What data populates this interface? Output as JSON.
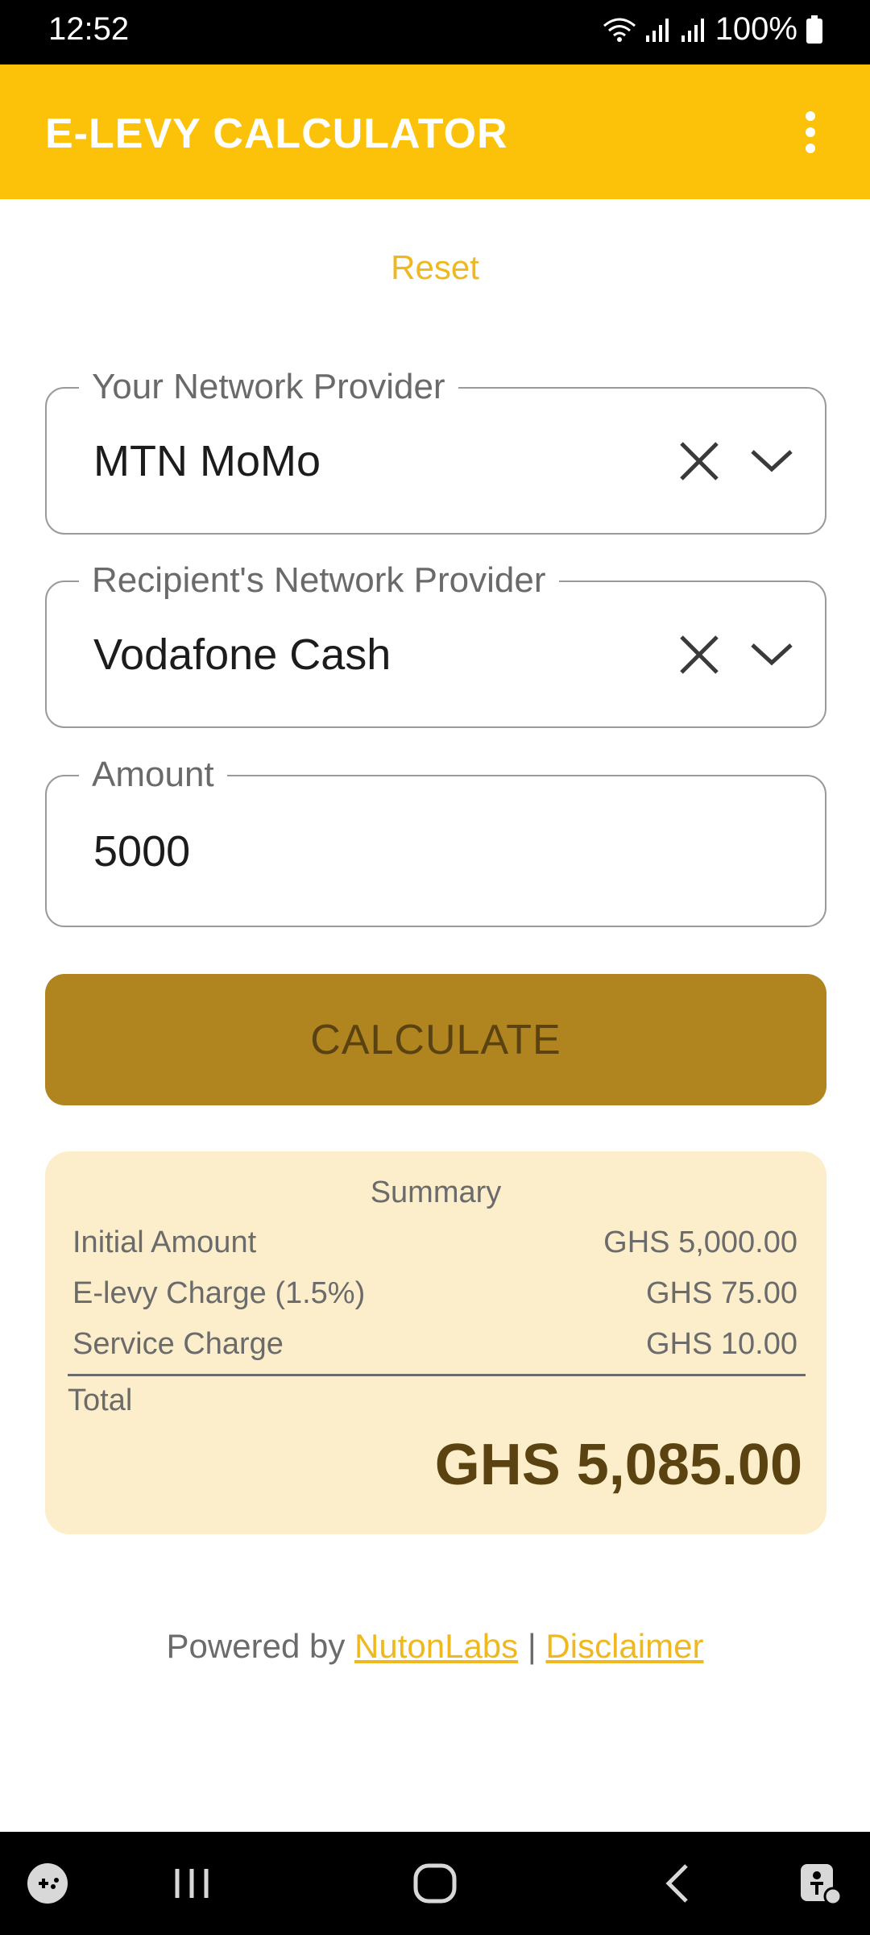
{
  "status_bar": {
    "time": "12:52",
    "battery": "100%"
  },
  "app_bar": {
    "title": "E-LEVY CALCULATOR",
    "overflow_icon": "more-vert-icon"
  },
  "reset_label": "Reset",
  "form": {
    "sender_provider": {
      "label": "Your Network Provider",
      "value": "MTN MoMo"
    },
    "recipient_provider": {
      "label": "Recipient's Network Provider",
      "value": "Vodafone Cash"
    },
    "amount": {
      "label": "Amount",
      "value": "5000"
    }
  },
  "calculate_label": "CALCULATE",
  "summary": {
    "title": "Summary",
    "rows": [
      {
        "label": "Initial Amount",
        "value": "GHS 5,000.00"
      },
      {
        "label": "E-levy Charge (1.5%)",
        "value": "GHS 75.00"
      },
      {
        "label": "Service Charge",
        "value": "GHS 10.00"
      }
    ],
    "total_label": "Total",
    "total_value": "GHS 5,085.00"
  },
  "footer": {
    "prefix": "Powered by ",
    "company_link": "NutonLabs",
    "separator": " | ",
    "disclaimer_link": "Disclaimer"
  },
  "colors": {
    "accent": "#fcc20a",
    "button": "#b08520",
    "summary_bg": "#fdeecb",
    "link": "#f0b820"
  }
}
